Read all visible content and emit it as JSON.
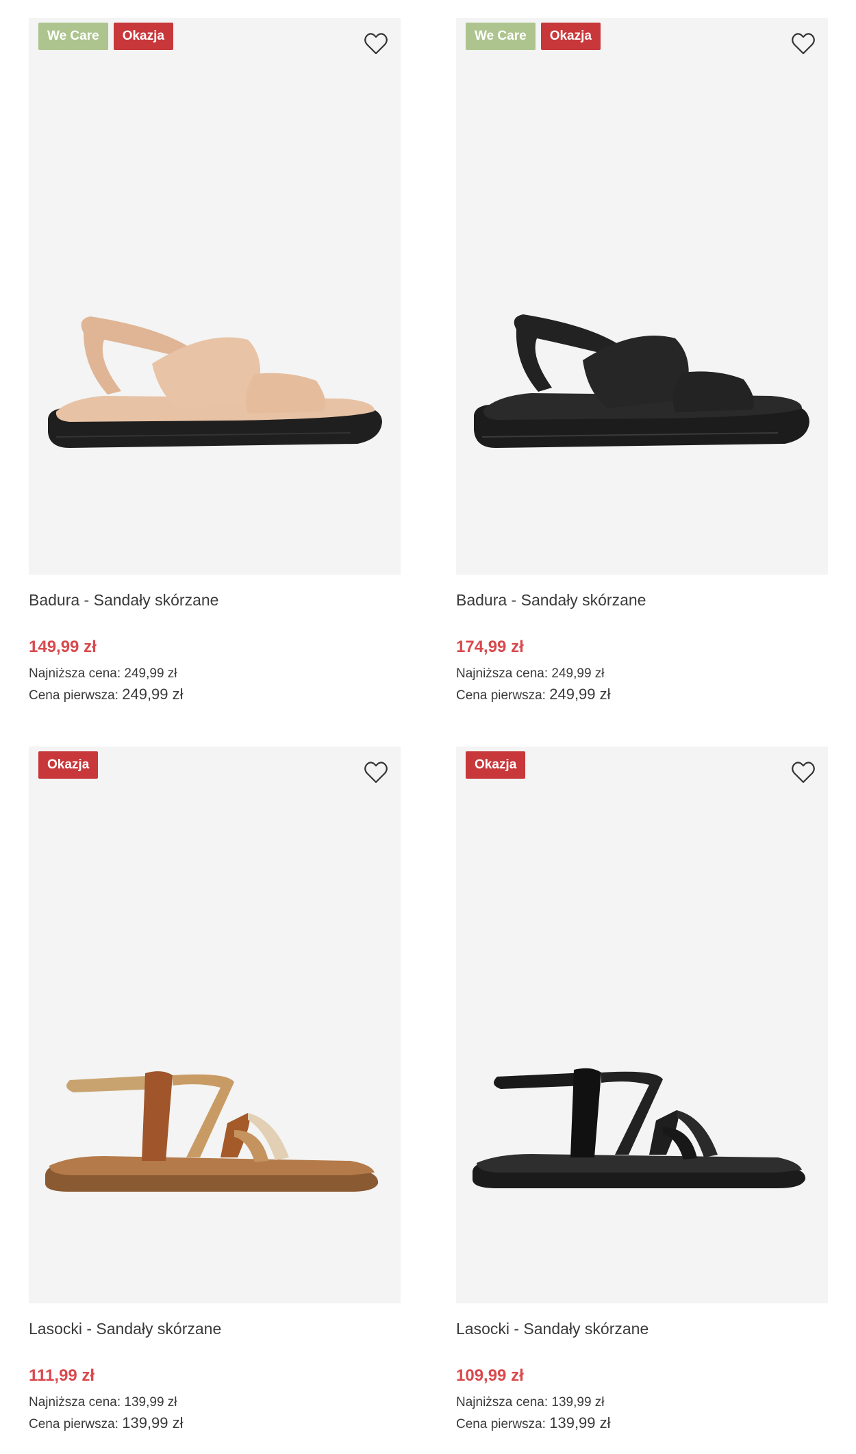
{
  "colors": {
    "we_care_badge": "#adc48e",
    "deal_badge": "#c8373a",
    "price": "#d9494d",
    "image_bg": "#f3f4f3"
  },
  "products": [
    {
      "badges": [
        "We Care",
        "Okazja"
      ],
      "title": "Badura - Sandały skórzane",
      "price": "149,99 zł",
      "lowest_label": "Najniższa cena:",
      "lowest_value": "249,99 zł",
      "first_label": "Cena pierwsza:",
      "first_value": "249,99 zł",
      "wishlist_icon": "heart-icon"
    },
    {
      "badges": [
        "We Care",
        "Okazja"
      ],
      "title": "Badura - Sandały skórzane",
      "price": "174,99 zł",
      "lowest_label": "Najniższa cena:",
      "lowest_value": "249,99 zł",
      "first_label": "Cena pierwsza:",
      "first_value": "249,99 zł",
      "wishlist_icon": "heart-icon"
    },
    {
      "badges": [
        "Okazja"
      ],
      "title": "Lasocki - Sandały skórzane",
      "price": "111,99 zł",
      "lowest_label": "Najniższa cena:",
      "lowest_value": "139,99 zł",
      "first_label": "Cena pierwsza:",
      "first_value": "139,99 zł",
      "wishlist_icon": "heart-icon"
    },
    {
      "badges": [
        "Okazja"
      ],
      "title": "Lasocki - Sandały skórzane",
      "price": "109,99 zł",
      "lowest_label": "Najniższa cena:",
      "lowest_value": "139,99 zł",
      "first_label": "Cena pierwsza:",
      "first_value": "139,99 zł",
      "wishlist_icon": "heart-icon"
    }
  ]
}
